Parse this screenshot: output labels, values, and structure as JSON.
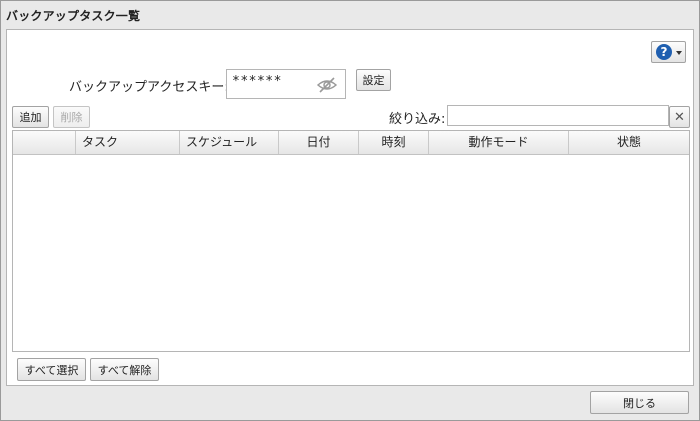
{
  "dialog": {
    "title": "バックアップタスク一覧",
    "close_label": "閉じる"
  },
  "help": {
    "icon_glyph": "?",
    "icon": "help-icon"
  },
  "access_key": {
    "label": "バックアップアクセスキー:",
    "value": "******",
    "set_label": "設定",
    "visibility_icon": "eye-slash-icon"
  },
  "toolbar": {
    "add_label": "追加",
    "delete_label": "削除",
    "filter_label": "絞り込み:",
    "filter_value": "",
    "clear_glyph": "✕"
  },
  "table": {
    "columns": [
      "",
      "タスク",
      "スケジュール",
      "日付",
      "時刻",
      "動作モード",
      "状態"
    ],
    "rows": []
  },
  "footer": {
    "select_all_label": "すべて選択",
    "deselect_all_label": "すべて解除"
  }
}
